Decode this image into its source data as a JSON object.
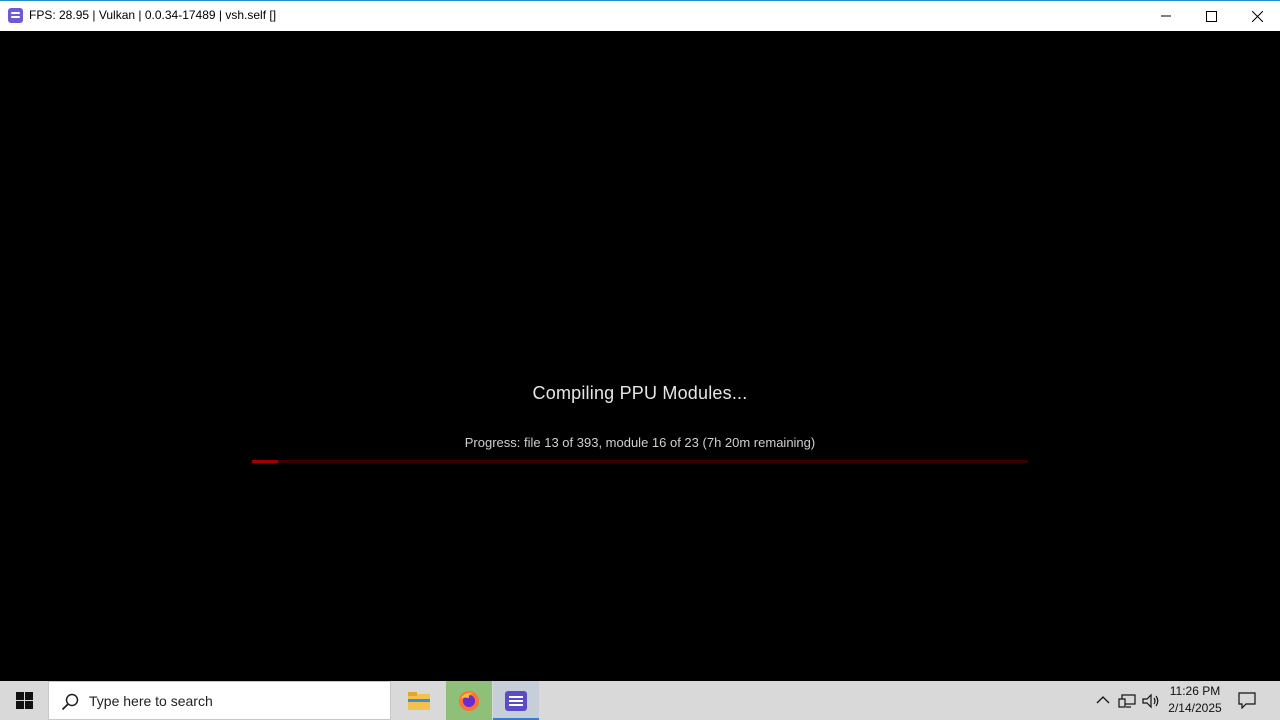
{
  "window": {
    "title": "FPS: 28.95 | Vulkan | 0.0.34-17489 | vsh.self []",
    "icon": "rpcs3-app-icon"
  },
  "content": {
    "heading": "Compiling PPU Modules...",
    "progress_text": "Progress: file 13 of 393, module 16 of 23 (7h 20m remaining)",
    "progress_fraction": 0.033,
    "bar_track_color": "#3a0000",
    "bar_fill_color": "#a00000"
  },
  "taskbar": {
    "search_placeholder": "Type here to search",
    "apps": [
      "file-explorer-icon",
      "firefox-icon",
      "rpcs3-icon"
    ],
    "clock_time": "11:26 PM",
    "clock_date": "2/14/2025"
  }
}
